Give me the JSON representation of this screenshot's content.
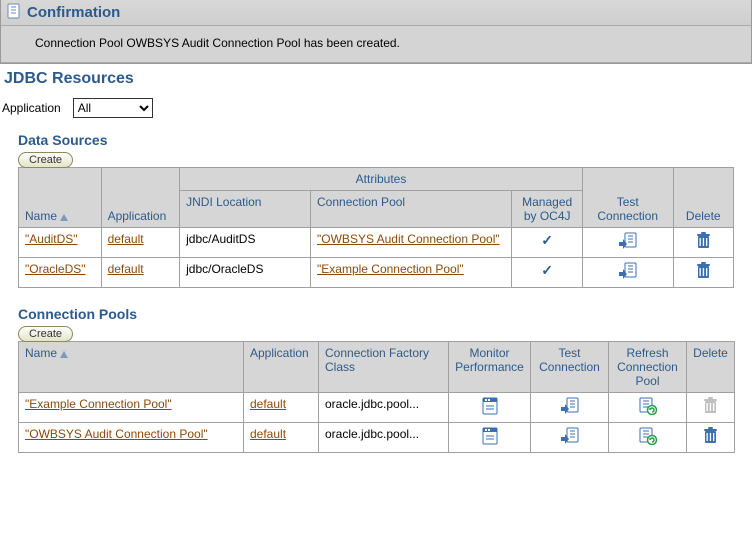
{
  "confirmation": {
    "title": "Confirmation",
    "message": "Connection Pool OWBSYS Audit Connection Pool has been created."
  },
  "page_title": "JDBC Resources",
  "application_field": {
    "label": "Application",
    "selected": "All",
    "options": [
      "All"
    ]
  },
  "data_sources_section": {
    "title": "Data Sources",
    "create_label": "Create",
    "attributes_header": "Attributes",
    "columns": {
      "name": "Name",
      "application": "Application",
      "jndi": "JNDI Location",
      "conn_pool": "Connection Pool",
      "managed": "Managed by OC4J",
      "test": "Test Connection",
      "delete": "Delete"
    },
    "rows": [
      {
        "name": "\"AuditDS\"",
        "application": "default",
        "jndi": "jdbc/AuditDS",
        "conn_pool": "\"OWBSYS Audit Connection Pool\"",
        "managed": true,
        "can_delete": true
      },
      {
        "name": "\"OracleDS\"",
        "application": "default",
        "jndi": "jdbc/OracleDS",
        "conn_pool": "\"Example Connection Pool\"",
        "managed": true,
        "can_delete": true
      }
    ]
  },
  "connection_pools_section": {
    "title": "Connection Pools",
    "create_label": "Create",
    "columns": {
      "name": "Name",
      "application": "Application",
      "factory": "Connection Factory Class",
      "monitor": "Monitor Performance",
      "test": "Test Connection",
      "refresh": "Refresh Connection Pool",
      "delete": "Delete"
    },
    "rows": [
      {
        "name": "\"Example Connection Pool\"",
        "application": "default",
        "factory": "oracle.jdbc.pool...",
        "can_delete": false
      },
      {
        "name": "\"OWBSYS Audit Connection Pool\"",
        "application": "default",
        "factory": "oracle.jdbc.pool...",
        "can_delete": true
      }
    ]
  }
}
